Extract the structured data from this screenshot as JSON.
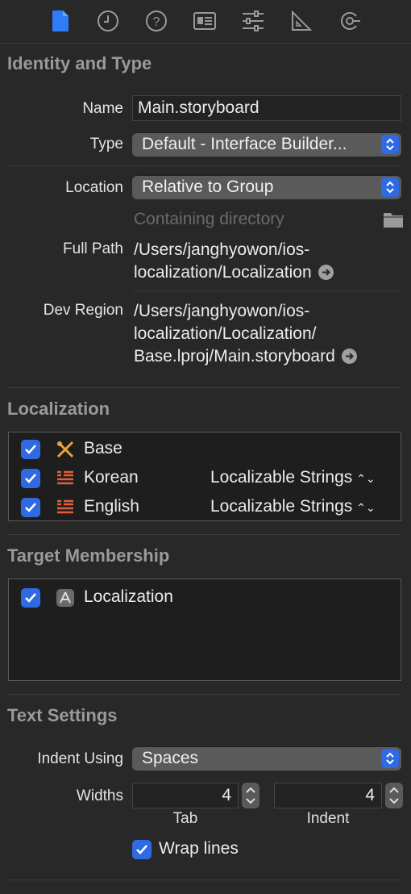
{
  "tabs": [
    {
      "icon": "file-icon",
      "active": true
    },
    {
      "icon": "history-icon"
    },
    {
      "icon": "help-icon"
    },
    {
      "icon": "identity-card-icon"
    },
    {
      "icon": "sliders-icon"
    },
    {
      "icon": "ruler-icon"
    },
    {
      "icon": "connections-icon"
    }
  ],
  "identity": {
    "title": "Identity and Type",
    "name_label": "Name",
    "name_value": "Main.storyboard",
    "type_label": "Type",
    "type_value": "Default - Interface Builder...",
    "location_label": "Location",
    "location_value": "Relative to Group",
    "containing_placeholder": "Containing directory",
    "full_path_label": "Full Path",
    "full_path_line1": "/Users/janghyowon/ios-",
    "full_path_line2": "localization/Localization",
    "dev_region_label": "Dev Region",
    "dev_region_line1": "/Users/janghyowon/ios-",
    "dev_region_line2": "localization/Localization/",
    "dev_region_line3": "Base.lproj/Main.storyboard"
  },
  "localization": {
    "title": "Localization",
    "items": [
      {
        "label": "Base",
        "type": ""
      },
      {
        "label": "Korean",
        "type": "Localizable Strings"
      },
      {
        "label": "English",
        "type": "Localizable Strings"
      }
    ]
  },
  "target_membership": {
    "title": "Target Membership",
    "items": [
      {
        "label": "Localization"
      }
    ]
  },
  "text_settings": {
    "title": "Text Settings",
    "indent_label": "Indent Using",
    "indent_value": "Spaces",
    "widths_label": "Widths",
    "tab_value": "4",
    "indent_width_value": "4",
    "tab_label": "Tab",
    "indent_sub_label": "Indent",
    "wrap_label": "Wrap lines"
  },
  "colors": {
    "accent": "#2f6ae3",
    "background": "#282828"
  }
}
